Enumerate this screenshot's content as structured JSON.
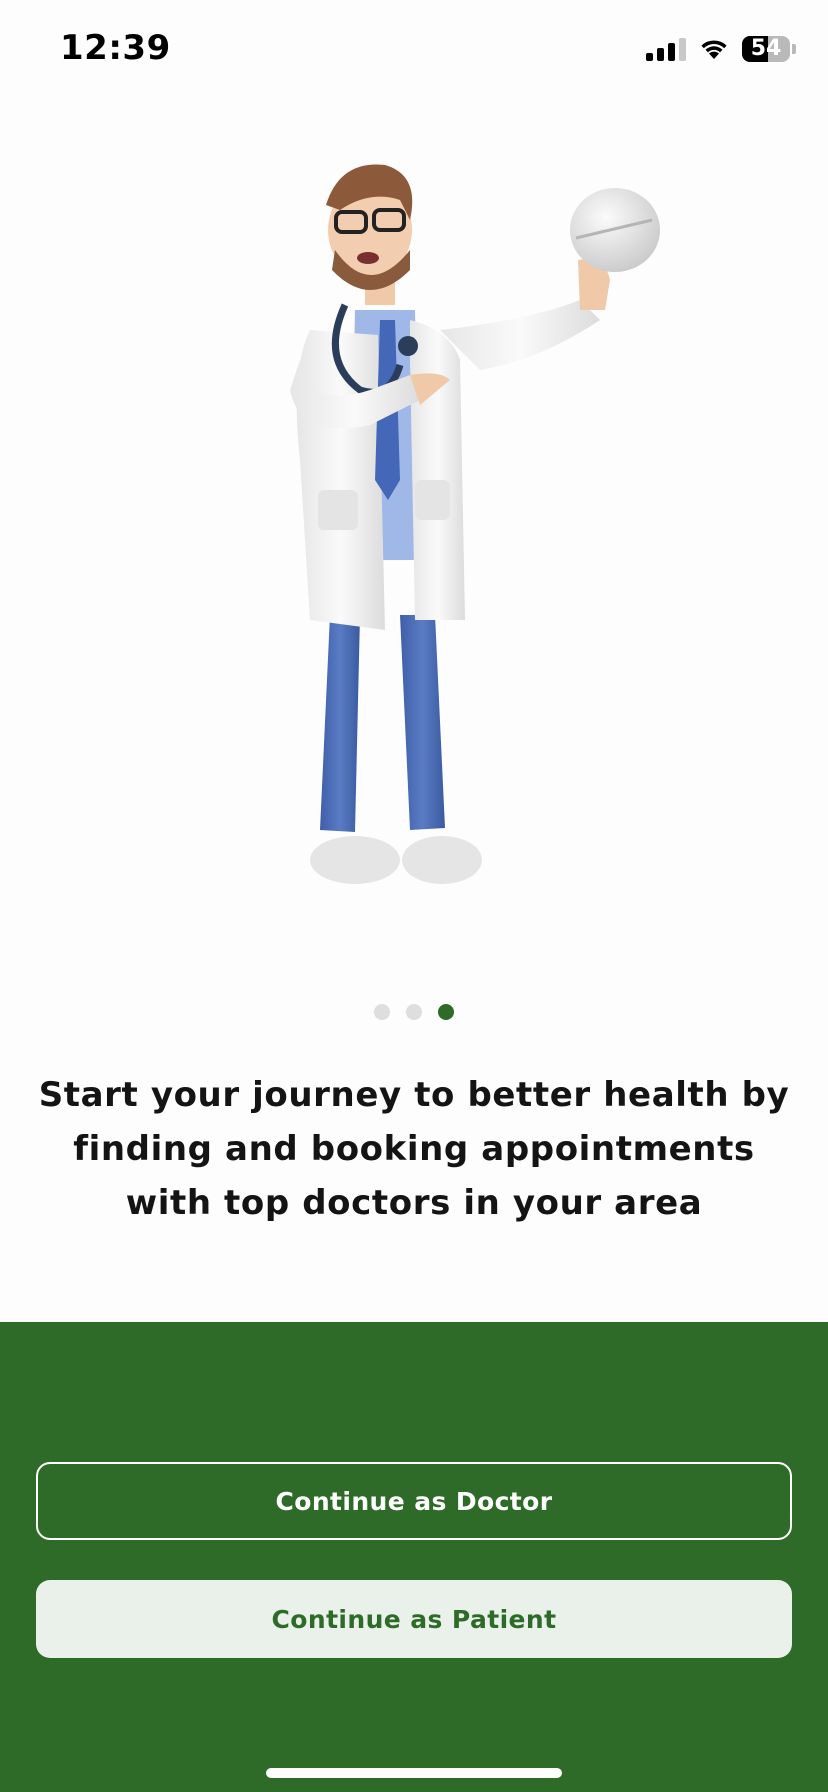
{
  "status_bar": {
    "time": "12:39",
    "battery_level": "54",
    "battery_percent": 54,
    "signal_bars": 3,
    "icons": [
      "cellular-signal-icon",
      "wifi-icon",
      "battery-icon"
    ]
  },
  "illustration": {
    "icon": "doctor-holding-pill-illustration"
  },
  "pager": {
    "total": 3,
    "active_index": 2
  },
  "onboarding": {
    "tagline": "Start your journey to better health by finding and booking appointments with top doctors in your area"
  },
  "actions": {
    "doctor_label": "Continue as Doctor",
    "patient_label": "Continue as Patient"
  },
  "colors": {
    "brand_green": "#2f6b28",
    "active_dot": "#2e6b28",
    "inactive_dot": "#dedede",
    "patient_button_bg": "#eaf1ea",
    "page_bg": "#fdfdfd"
  }
}
